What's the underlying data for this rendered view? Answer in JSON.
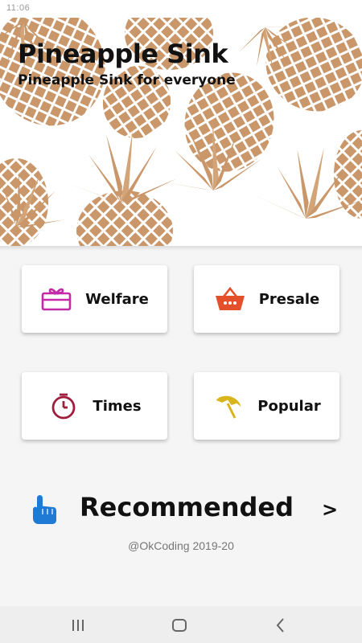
{
  "status_bar": {
    "time": "11:06",
    "right": ""
  },
  "header": {
    "title": "Pineapple Sink",
    "subtitle": "Pineapple Sink for everyone"
  },
  "menu": [
    {
      "label": "Welfare",
      "icon": "gift-icon",
      "color": "#c42aa8"
    },
    {
      "label": "Presale",
      "icon": "basket-icon",
      "color": "#e4502a"
    },
    {
      "label": "Times",
      "icon": "stopwatch-icon",
      "color": "#a01d3e"
    },
    {
      "label": "Popular",
      "icon": "beach-umbrella-icon",
      "color": "#d9b51c"
    }
  ],
  "recommended": {
    "title": "Recommended",
    "arrow": ">",
    "icon": "pointing-hand-icon",
    "icon_color": "#1f7ad6"
  },
  "footer": {
    "copyright": "@OkCoding 2019-20"
  },
  "nav": {
    "recents": "recents-icon",
    "home": "home-icon",
    "back": "back-icon"
  },
  "colors": {
    "pineapple": "#c9976a",
    "pineapple_light": "#dcb089",
    "background": "#f5f5f5"
  }
}
